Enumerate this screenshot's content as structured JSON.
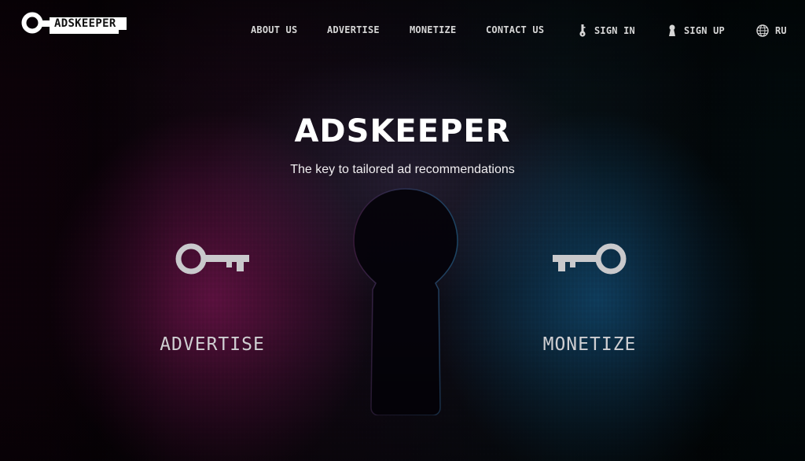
{
  "header": {
    "logo_text": "ADSKEEPER",
    "nav": [
      {
        "label": "ABOUT US",
        "icon": null
      },
      {
        "label": "ADVERTISE",
        "icon": null
      },
      {
        "label": "MONETIZE",
        "icon": null
      },
      {
        "label": "CONTACT US",
        "icon": null
      },
      {
        "label": "SIGN IN",
        "icon": "key-icon"
      },
      {
        "label": "SIGN UP",
        "icon": "keyhole-icon"
      },
      {
        "label": "RU",
        "icon": "globe-icon"
      }
    ]
  },
  "hero": {
    "title": "ADSKEEPER",
    "subtitle": "The key to tailored ad recommendations",
    "advertise": {
      "label": "ADVERTISE",
      "icon": "key-icon"
    },
    "monetize": {
      "label": "MONETIZE",
      "icon": "key-icon"
    }
  },
  "colors": {
    "text_primary": "#ffffff",
    "nav_text": "#d6d6d6",
    "cta_text": "#cfcfd2",
    "icon_gray": "#c9c9cc",
    "accent_magenta": "#961964",
    "accent_blue": "#145a8c"
  }
}
